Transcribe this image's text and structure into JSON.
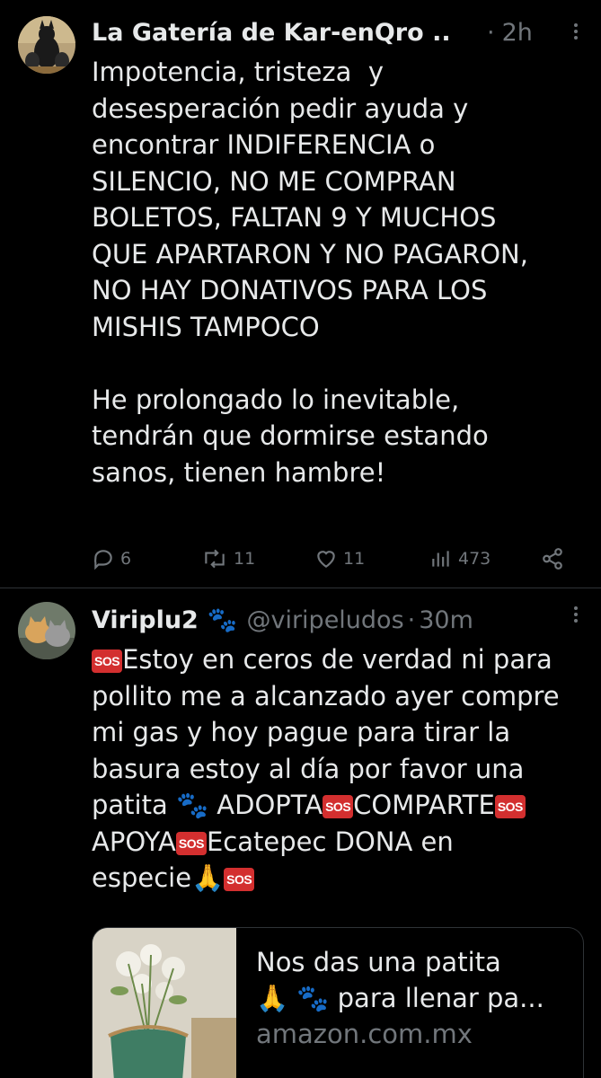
{
  "tweets": [
    {
      "display_name": "La Gatería de Kar-enQro ...",
      "separator": "·",
      "time": "2h",
      "text": "Impotencia, tristeza  y\ndesesperación pedir ayuda y\nencontrar INDIFERENCIA o\nSILENCIO, NO ME COMPRAN\nBOLETOS, FALTAN 9 Y MUCHOS\nQUE APARTARON Y NO PAGARON,\nNO HAY DONATIVOS PARA LOS\nMISHIS TAMPOCO\n\nHe prolongado lo inevitable,\ntendrán que dormirse estando\nsanos, tienen hambre!",
      "stats": {
        "replies": "6",
        "reposts": "11",
        "likes": "11",
        "views": "473"
      }
    },
    {
      "display_name": "Viriplu2",
      "name_emoji": "🐾",
      "handle": "@viripeludos",
      "separator": "·",
      "time": "30m",
      "sos_label": "SOS",
      "text": {
        "line1": "Estoy en ceros de verdad ni para",
        "line2": "pollito me a alcanzado ayer compre",
        "line3": "mi gas y hoy pague para tirar la",
        "line4": "basura estoy al día por favor una",
        "line5a": "patita ",
        "paw": "🐾",
        "line5b": " ADOPTA",
        "line5c": "COMPARTE",
        "line6a": "APOYA",
        "line6b": "Ecatepec DONA en",
        "line7a": "especie",
        "pray": "🙏"
      },
      "card": {
        "title": "Nos das una patita\n🙏 🐾 para llenar pa...",
        "domain": "amazon.com.mx"
      }
    }
  ],
  "icons": {
    "more": "more-icon",
    "reply": "reply-icon",
    "repost": "repost-icon",
    "like": "heart-icon",
    "views": "views-icon",
    "share": "share-icon"
  },
  "colors": {
    "background": "#000000",
    "text": "#e7e9ea",
    "muted": "#71767b",
    "divider": "#2f3336",
    "sos_red": "#d32f2f"
  }
}
